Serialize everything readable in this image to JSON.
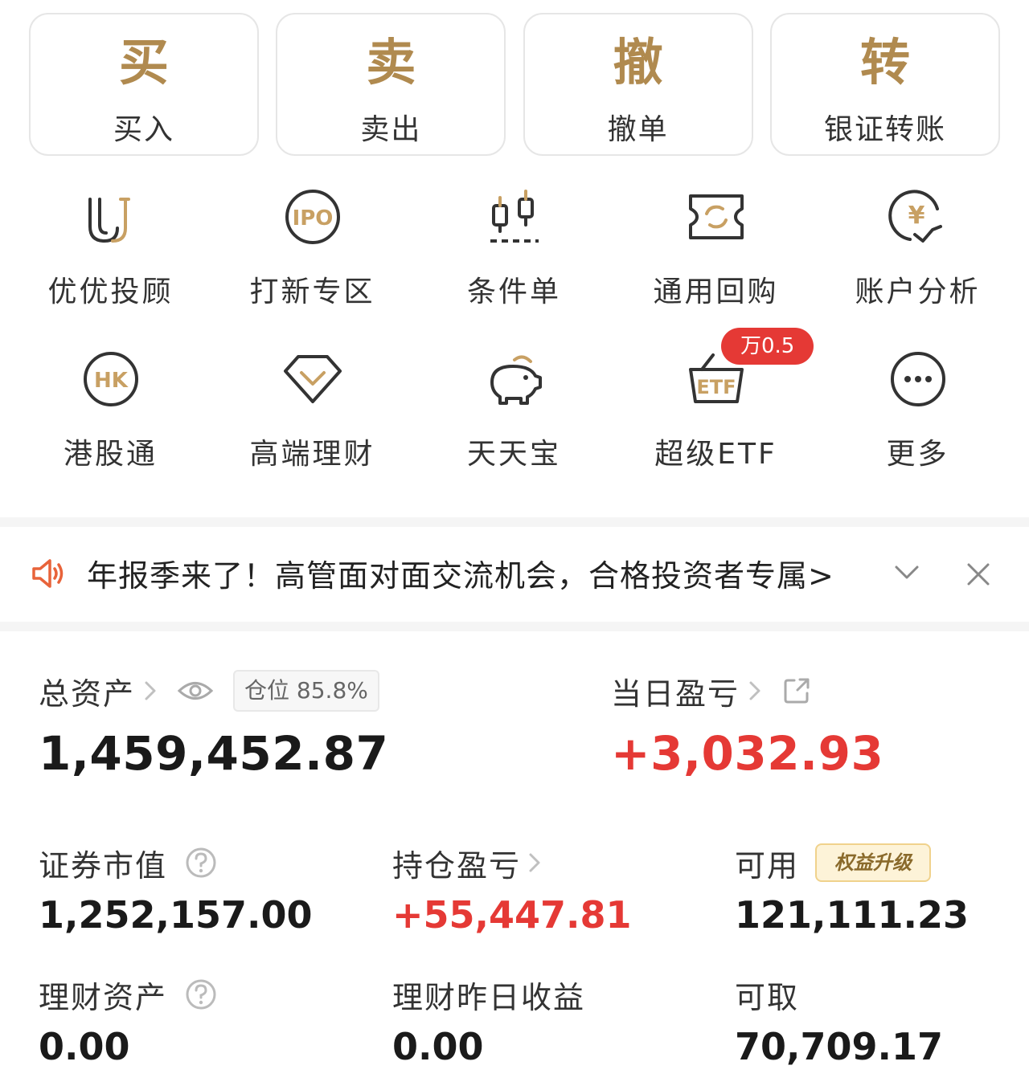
{
  "trade_buttons": [
    {
      "glyph": "买",
      "label": "买入"
    },
    {
      "glyph": "卖",
      "label": "卖出"
    },
    {
      "glyph": "撤",
      "label": "撤单"
    },
    {
      "glyph": "转",
      "label": "银证转账"
    }
  ],
  "grid": [
    {
      "icon": "youyou-advisor-icon",
      "label": "优优投顾"
    },
    {
      "icon": "ipo-icon",
      "icon_text": "IPO",
      "label": "打新专区"
    },
    {
      "icon": "candlestick-icon",
      "label": "条件单"
    },
    {
      "icon": "repo-ticket-icon",
      "label": "通用回购"
    },
    {
      "icon": "yen-analysis-icon",
      "icon_text": "¥",
      "label": "账户分析"
    },
    {
      "icon": "hk-icon",
      "icon_text": "HK",
      "label": "港股通"
    },
    {
      "icon": "diamond-icon",
      "label": "高端理财"
    },
    {
      "icon": "piggy-bank-icon",
      "label": "天天宝"
    },
    {
      "icon": "etf-basket-icon",
      "icon_text": "ETF",
      "label": "超级ETF",
      "badge": "万0.5"
    },
    {
      "icon": "more-icon",
      "label": "更多"
    }
  ],
  "notice": {
    "text": "年报季来了！高管面对面交流机会，合格投资者专属>"
  },
  "assets": {
    "total_label": "总资产",
    "position_tag": "仓位 85.8%",
    "total_value": "1,459,452.87",
    "daily_pl_label": "当日盈亏",
    "daily_pl_value": "+3,032.93",
    "market_value_label": "证券市值",
    "market_value": "1,252,157.00",
    "holding_pl_label": "持仓盈亏",
    "holding_pl_value": "+55,447.81",
    "available_label": "可用",
    "upgrade_tag": "权益升级",
    "available_value": "121,111.23",
    "wealth_label": "理财资产",
    "wealth_value": "0.00",
    "wealth_yesterday_label": "理财昨日收益",
    "wealth_yesterday_value": "0.00",
    "withdrawable_label": "可取",
    "withdrawable_value": "70,709.17"
  },
  "colors": {
    "gold": "#b08a4f",
    "red": "#e53935",
    "notice_icon": "#e8633a"
  }
}
